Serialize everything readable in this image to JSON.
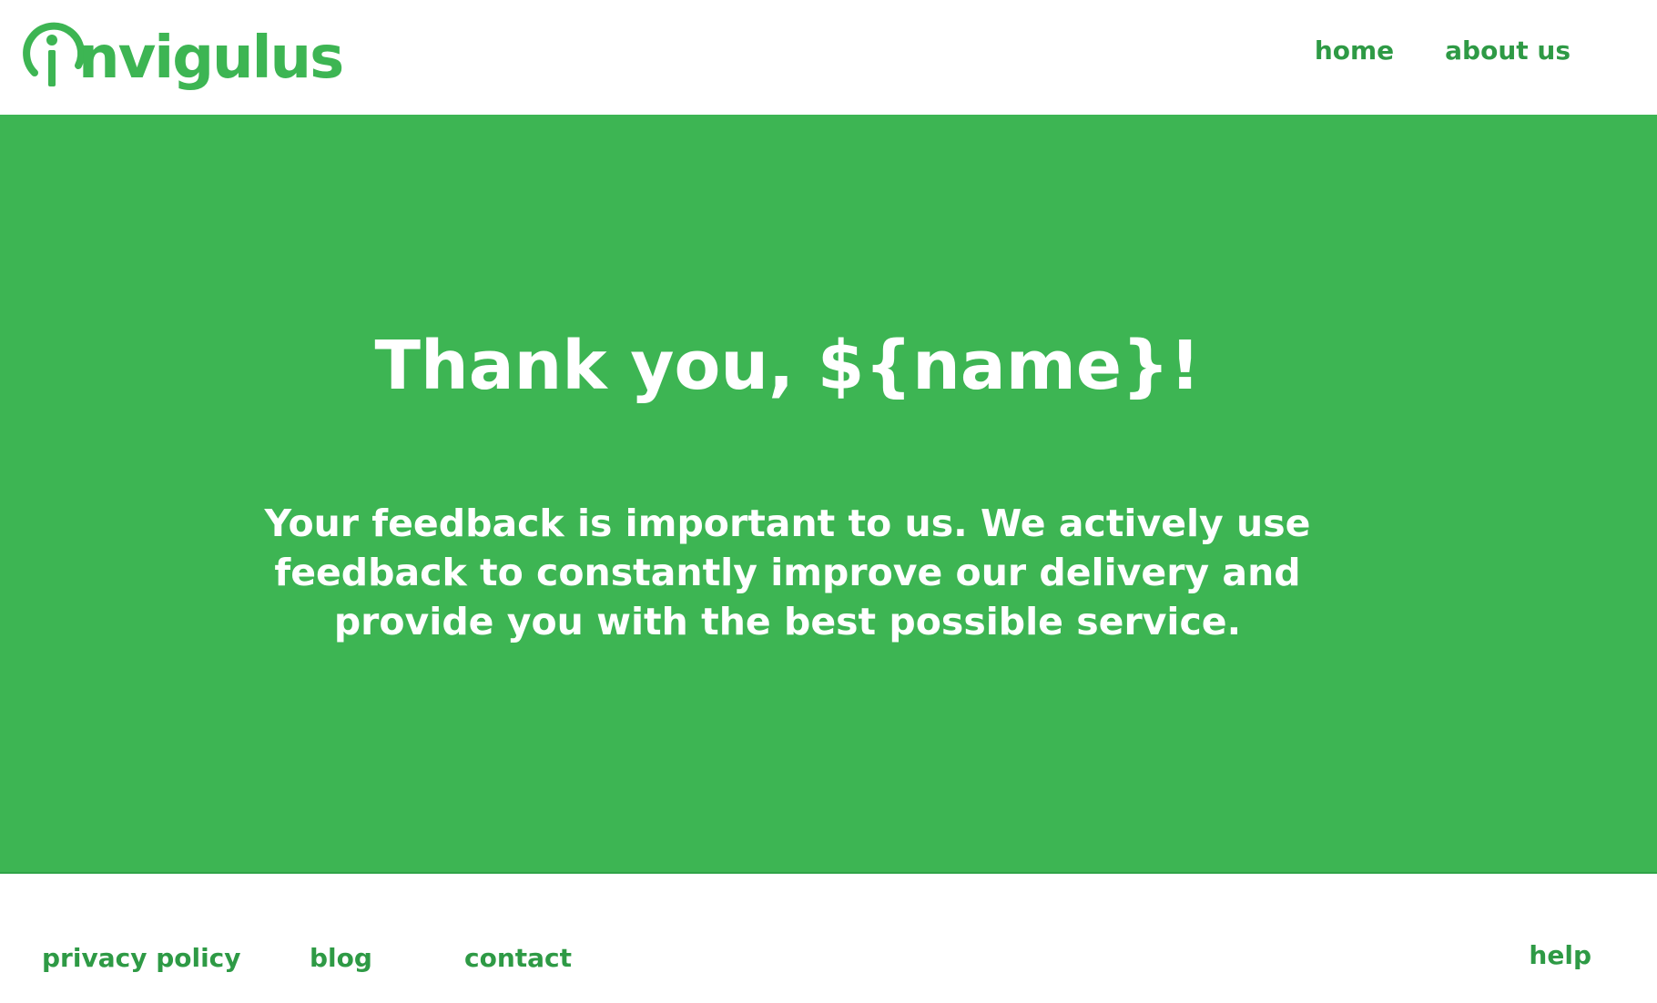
{
  "brand": {
    "logo_text": "nvigulus",
    "logo_alt": "Invigulus",
    "color": "#3db553"
  },
  "nav": {
    "items": [
      {
        "label": "home"
      },
      {
        "label": "about us"
      }
    ]
  },
  "hero": {
    "background": "#3db553",
    "title": "Thank you, ${name}!",
    "message_lines": [
      "Your feedback is important to us. We actively use",
      "feedback to constantly improve our delivery and",
      "provide you with the best possible service."
    ]
  },
  "footer": {
    "links": [
      {
        "label": "privacy policy"
      },
      {
        "label": "blog"
      },
      {
        "label": "contact"
      }
    ],
    "help_label": "help"
  }
}
